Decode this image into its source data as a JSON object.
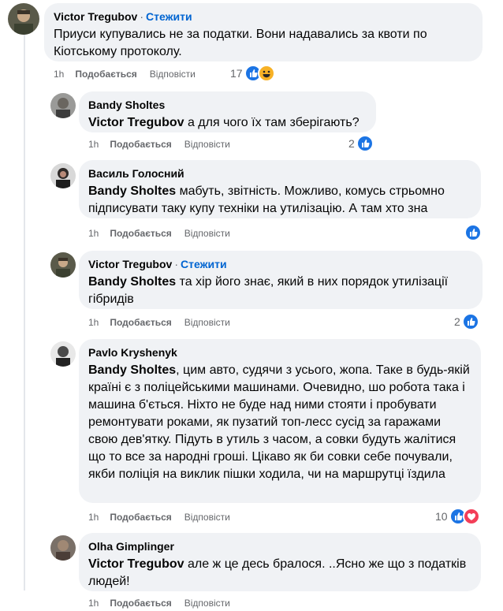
{
  "comments": [
    {
      "author": "Victor Tregubov",
      "follow": "Стежити",
      "mention": "",
      "text": "Приуси купувались не за податки. Вони надавались за квоти по Кіотському протоколу.",
      "time": "1h",
      "like": "Подобається",
      "reply": "Відповісти",
      "reaction_count": "17",
      "reactions": [
        "like-icon",
        "haha-icon"
      ]
    },
    {
      "author": "Bandy Sholtes",
      "follow": "",
      "mention": "Victor Tregubov",
      "text": " а для чого їх там зберігають?",
      "time": "1h",
      "like": "Подобається",
      "reply": "Відповісти",
      "reaction_count": "2",
      "reactions": [
        "like-icon"
      ]
    },
    {
      "author": "Василь Голосний",
      "follow": "",
      "mention": "Bandy Sholtes",
      "text": " мабуть, звітність. Можливо, комусь стрьомно підписувати таку купу техніки на утилізацію. А там хто зна",
      "time": "1h",
      "like": "Подобається",
      "reply": "Відповісти",
      "reaction_count": "",
      "reactions": [
        "like-icon"
      ]
    },
    {
      "author": "Victor Tregubov",
      "follow": "Стежити",
      "mention": "Bandy Sholtes",
      "text": " та хір його знає, який в них порядок утилізації гібридів",
      "time": "1h",
      "like": "Подобається",
      "reply": "Відповісти",
      "reaction_count": "2",
      "reactions": [
        "like-icon"
      ]
    },
    {
      "author": "Pavlo Kryshenyk",
      "follow": "",
      "mention": "Bandy Sholtes",
      "text": ", цим авто, судячи з усього, жопа. Таке в будь-якій країні є з поліцейськими машинами. Очевидно, шо робота така і машина б'ється. Ніхто не буде над ними стояти і пробувати ремонтувати роками, як пузатий топ-лесс сусід за гаражами свою дев'ятку. Підуть в утиль з часом, а совки будуть жалітися що то все за народні гроші. Цікаво як би совки себе почували, якби поліція на виклик пішки ходила, чи на маршрутці їздила",
      "time": "1h",
      "like": "Подобається",
      "reply": "Відповісти",
      "reaction_count": "10",
      "reactions": [
        "like-icon",
        "love-icon"
      ]
    },
    {
      "author": "Olha Gimplinger",
      "follow": "",
      "mention": "Victor Tregubov",
      "text": " але ж це десь бралося. ..Ясно же що з податків людей!",
      "time": "1h",
      "like": "Подобається",
      "reply": "Відповісти",
      "reaction_count": "",
      "reactions": []
    }
  ],
  "colors": {
    "bubble": "#f0f2f5",
    "link": "#0064d1",
    "muted": "#65676b",
    "like": "#1b74e4",
    "haha": "#f7b125",
    "love": "#f33e58"
  }
}
